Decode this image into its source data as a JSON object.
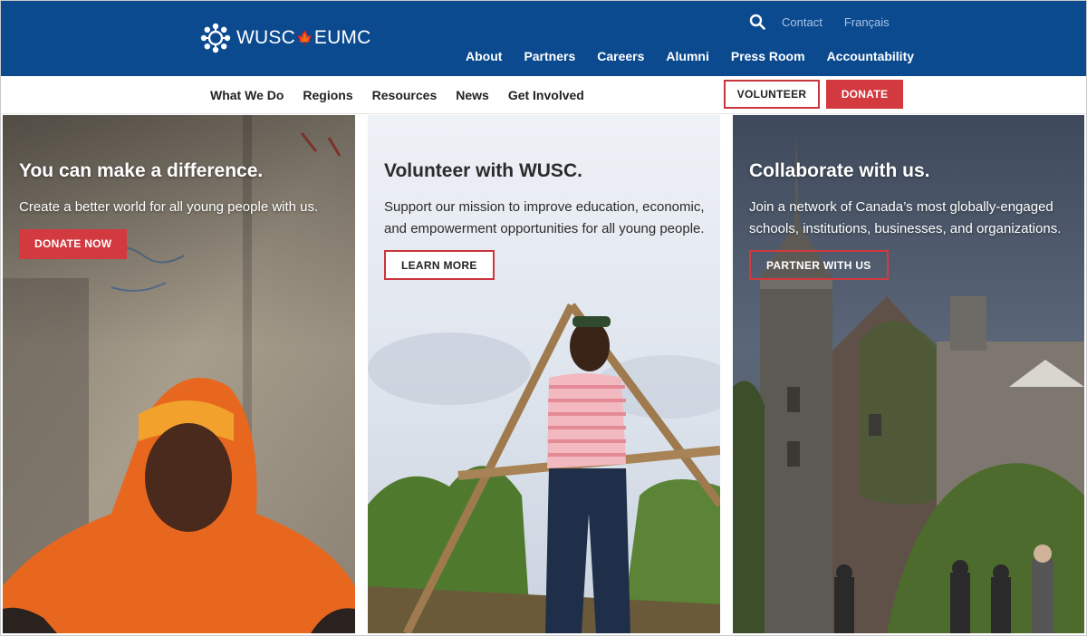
{
  "brand": {
    "name_left": "WUSC",
    "name_right": "EUMC",
    "leaf_glyph": "🍁"
  },
  "colors": {
    "header_blue": "#0b4a8f",
    "accent_red": "#d23a3f",
    "util_link": "#a9c4e6"
  },
  "utility_nav": {
    "contact": "Contact",
    "language": "Français",
    "search_icon": "search-icon"
  },
  "main_nav": [
    "About",
    "Partners",
    "Careers",
    "Alumni",
    "Press Room",
    "Accountability"
  ],
  "sub_nav": [
    "What We Do",
    "Regions",
    "Resources",
    "News",
    "Get Involved"
  ],
  "header_buttons": {
    "volunteer": "VOLUNTEER",
    "donate": "DONATE"
  },
  "panels": [
    {
      "title": "You can make a difference.",
      "text": "Create a better world for all young people with us.",
      "cta": "DONATE NOW"
    },
    {
      "title": "Volunteer with WUSC.",
      "text": "Support our mission to improve education, economic, and empowerment opportunities for all young people.",
      "cta": "LEARN MORE"
    },
    {
      "title": "Collaborate with us.",
      "text": "Join a network of Canada’s most globally-engaged schools, institutions, businesses, and organizations.",
      "cta": "PARTNER WITH US"
    }
  ]
}
